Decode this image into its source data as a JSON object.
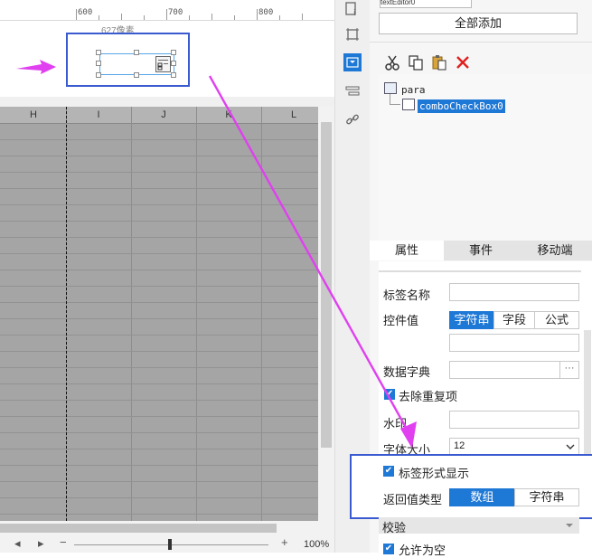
{
  "ruler": {
    "labels": [
      "600",
      "700",
      "800"
    ]
  },
  "param_area": {
    "pixel_label": "627像素"
  },
  "grid": {
    "columns": [
      "H",
      "I",
      "J",
      "K",
      "L"
    ]
  },
  "statusbar": {
    "prev": "◂",
    "next": "▸",
    "minus": "−",
    "plus": "+",
    "zoom": "100%"
  },
  "toolbar": {
    "icons": [
      "report-icon",
      "frame-icon",
      "widget-icon",
      "list-icon",
      "link-icon"
    ]
  },
  "panel": {
    "prev_field_text": "textEditor0",
    "add_all_label": "全部添加",
    "actions": [
      "cut-icon",
      "copy-icon",
      "paste-icon",
      "delete-icon"
    ],
    "tree": {
      "root": "para",
      "child": "comboCheckBox0"
    },
    "tabs": [
      "属性",
      "事件",
      "移动端"
    ],
    "props": {
      "tag_name_label": "标签名称",
      "control_value_label": "控件值",
      "control_value_options": [
        "字符串",
        "字段",
        "公式"
      ],
      "data_dict_label": "数据字典",
      "data_dict_button": "···",
      "dedupe_label": "去除重复项",
      "watermark_label": "水印",
      "font_size_label": "字体大小",
      "font_size_value": "12",
      "tag_display_label": "标签形式显示",
      "return_type_label": "返回值类型",
      "return_type_options": [
        "数组",
        "字符串"
      ],
      "validate_label": "校验",
      "allow_empty_label": "允许为空"
    }
  },
  "colors": {
    "accent": "#1e78d6",
    "annotation": "#e040f0",
    "highlight": "#3a5bd0"
  }
}
